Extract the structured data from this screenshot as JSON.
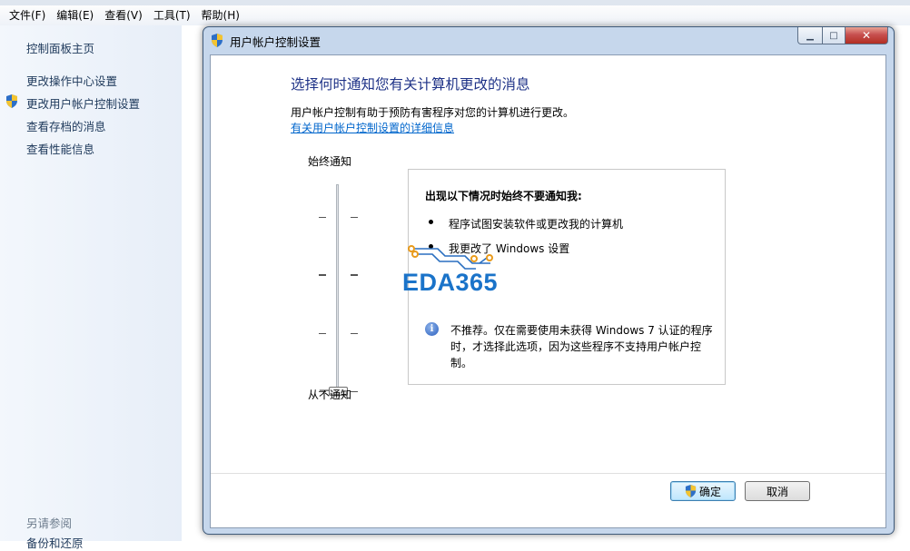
{
  "menu": [
    "文件(F)",
    "编辑(E)",
    "查看(V)",
    "工具(T)",
    "帮助(H)"
  ],
  "sidebar": {
    "items": [
      {
        "label": "控制面板主页"
      },
      {
        "label": "更改操作中心设置"
      },
      {
        "label": "更改用户帐户控制设置"
      },
      {
        "label": "查看存档的消息"
      },
      {
        "label": "查看性能信息"
      }
    ],
    "see_also_title": "另请参阅",
    "see_also_items": [
      "备份和还原"
    ]
  },
  "dialog": {
    "title": "用户帐户控制设置",
    "heading": "选择何时通知您有关计算机更改的消息",
    "description": "用户帐户控制有助于预防有害程序对您的计算机进行更改。",
    "learn_more": "有关用户帐户控制设置的详细信息",
    "slider": {
      "top_label": "始终通知",
      "bottom_label": "从不通知",
      "levels": 4,
      "selected_level": 1
    },
    "info": {
      "title": "出现以下情况时始终不要通知我:",
      "bullets": [
        "程序试图安装软件或更改我的计算机",
        "我更改了 Windows 设置"
      ],
      "note": "不推荐。仅在需要使用未获得 Windows 7 认证的程序时，才选择此选项，因为这些程序不支持用户帐户控制。"
    },
    "ok_label": "确定",
    "cancel_label": "取消"
  },
  "watermark": "EDA365",
  "colors": {
    "heading": "#1e3287",
    "link": "#0066cc",
    "accent": "#1a73c9"
  }
}
